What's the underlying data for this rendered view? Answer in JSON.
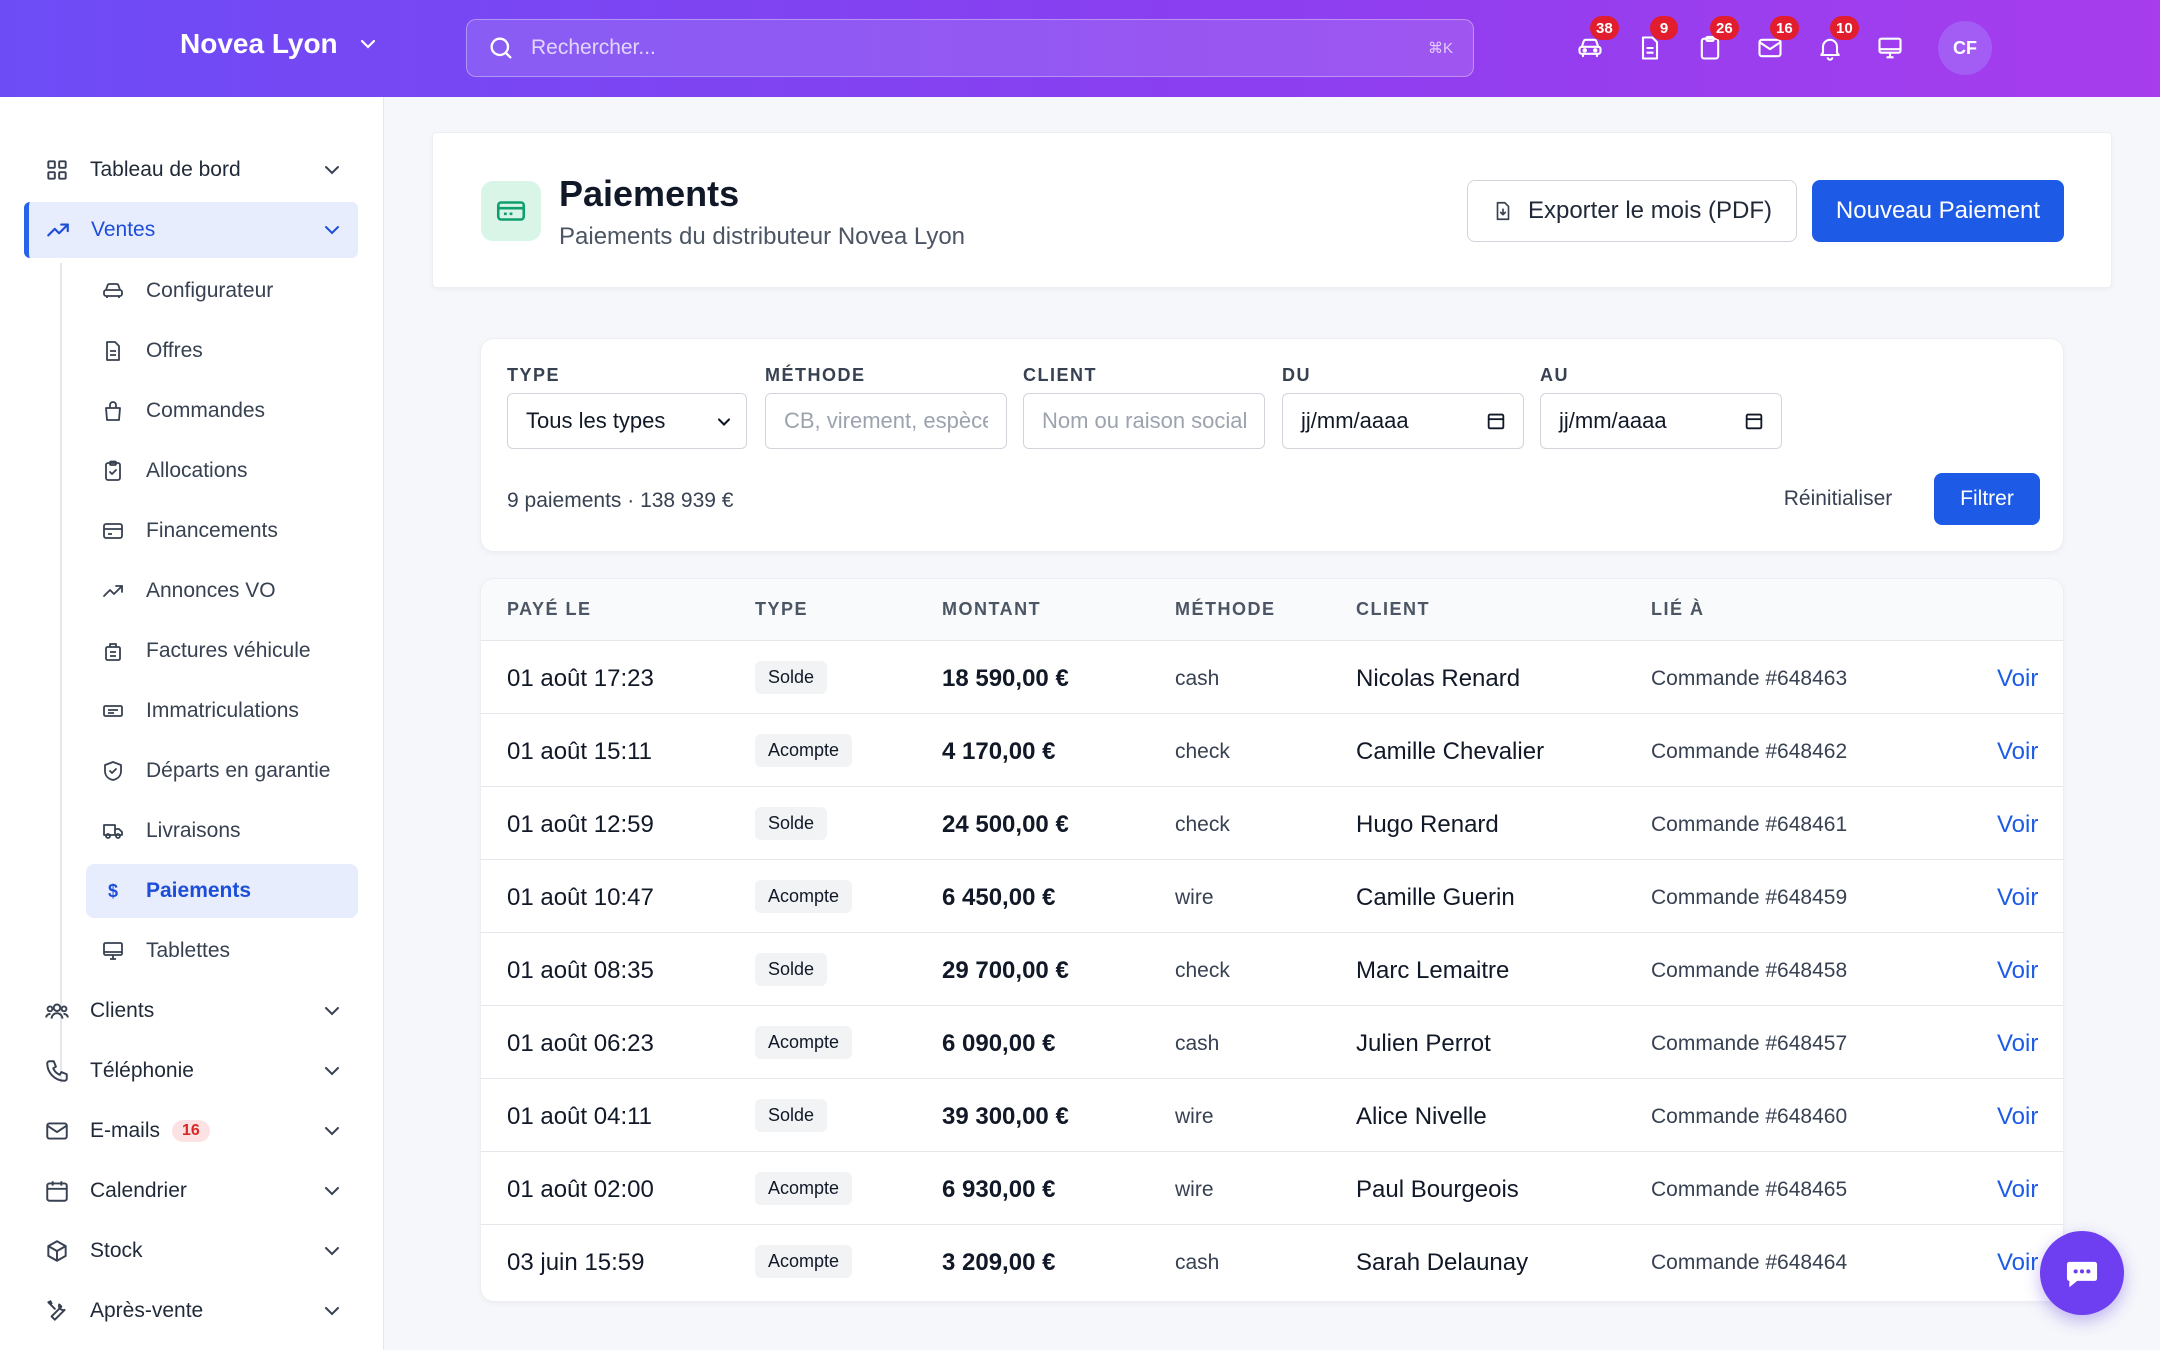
{
  "brand": {
    "name": "Novea Lyon"
  },
  "search": {
    "placeholder": "Rechercher...",
    "shortcut": "⌘K"
  },
  "notifications": [
    {
      "icon": "car-icon",
      "count": "38"
    },
    {
      "icon": "document-icon",
      "count": "9"
    },
    {
      "icon": "clipboard-icon",
      "count": "26"
    },
    {
      "icon": "mail-icon",
      "count": "16"
    },
    {
      "icon": "bell-icon",
      "count": "10"
    },
    {
      "icon": "monitor-icon",
      "count": ""
    }
  ],
  "user": {
    "initials": "CF"
  },
  "sidebar": {
    "sections": [
      {
        "label": "Tableau de bord",
        "icon": "grid-icon"
      },
      {
        "label": "Ventes",
        "icon": "trend-icon"
      },
      {
        "label": "Clients",
        "icon": "users-icon"
      },
      {
        "label": "Téléphonie",
        "icon": "phone-icon"
      },
      {
        "label": "E-mails",
        "icon": "mail-icon",
        "badge": "16"
      },
      {
        "label": "Calendrier",
        "icon": "calendar-icon"
      },
      {
        "label": "Stock",
        "icon": "cube-icon"
      },
      {
        "label": "Après-vente",
        "icon": "tools-icon"
      }
    ],
    "ventes_items": [
      {
        "label": "Configurateur",
        "icon": "car-icon"
      },
      {
        "label": "Offres",
        "icon": "document-icon"
      },
      {
        "label": "Commandes",
        "icon": "bag-icon"
      },
      {
        "label": "Allocations",
        "icon": "clipboard-check-icon"
      },
      {
        "label": "Financements",
        "icon": "credit-card-icon"
      },
      {
        "label": "Annonces VO",
        "icon": "trend-icon"
      },
      {
        "label": "Factures véhicule",
        "icon": "receipt-icon"
      },
      {
        "label": "Immatriculations",
        "icon": "plate-icon"
      },
      {
        "label": "Départs en garantie",
        "icon": "shield-icon"
      },
      {
        "label": "Livraisons",
        "icon": "truck-icon"
      },
      {
        "label": "Paiements",
        "icon": "dollar-icon"
      },
      {
        "label": "Tablettes",
        "icon": "monitor-icon"
      }
    ]
  },
  "header": {
    "title": "Paiements",
    "subtitle": "Paiements du distributeur Novea Lyon",
    "export_label": "Exporter le mois (PDF)",
    "new_label": "Nouveau Paiement"
  },
  "filters": {
    "type_label": "TYPE",
    "type_value": "Tous les types",
    "method_label": "MÉTHODE",
    "method_placeholder": "CB, virement, espèces",
    "client_label": "CLIENT",
    "client_placeholder": "Nom ou raison sociale",
    "from_label": "DU",
    "from_value": "jj/mm/aaaa",
    "to_label": "AU",
    "to_value": "jj/mm/aaaa",
    "count": "9 paiements · 138 939 €",
    "reset_label": "Réinitialiser",
    "filter_label": "Filtrer"
  },
  "table": {
    "headers": [
      "PAYÉ LE",
      "TYPE",
      "MONTANT",
      "MÉTHODE",
      "CLIENT",
      "LIÉ À"
    ],
    "action_label": "Voir",
    "rows": [
      {
        "date": "01 août 17:23",
        "type": "Solde",
        "amount": "18 590,00 €",
        "method": "cash",
        "client": "Nicolas Renard",
        "linked": "Commande #648463"
      },
      {
        "date": "01 août 15:11",
        "type": "Acompte",
        "amount": "4 170,00 €",
        "method": "check",
        "client": "Camille Chevalier",
        "linked": "Commande #648462"
      },
      {
        "date": "01 août 12:59",
        "type": "Solde",
        "amount": "24 500,00 €",
        "method": "check",
        "client": "Hugo Renard",
        "linked": "Commande #648461"
      },
      {
        "date": "01 août 10:47",
        "type": "Acompte",
        "amount": "6 450,00 €",
        "method": "wire",
        "client": "Camille Guerin",
        "linked": "Commande #648459"
      },
      {
        "date": "01 août 08:35",
        "type": "Solde",
        "amount": "29 700,00 €",
        "method": "check",
        "client": "Marc Lemaitre",
        "linked": "Commande #648458"
      },
      {
        "date": "01 août 06:23",
        "type": "Acompte",
        "amount": "6 090,00 €",
        "method": "cash",
        "client": "Julien Perrot",
        "linked": "Commande #648457"
      },
      {
        "date": "01 août 04:11",
        "type": "Solde",
        "amount": "39 300,00 €",
        "method": "wire",
        "client": "Alice Nivelle",
        "linked": "Commande #648460"
      },
      {
        "date": "01 août 02:00",
        "type": "Acompte",
        "amount": "6 930,00 €",
        "method": "wire",
        "client": "Paul Bourgeois",
        "linked": "Commande #648465"
      },
      {
        "date": "03 juin 15:59",
        "type": "Acompte",
        "amount": "3 209,00 €",
        "method": "cash",
        "client": "Sarah Delaunay",
        "linked": "Commande #648464"
      }
    ]
  },
  "colors": {
    "accent": "#1d5be6",
    "topbar_start": "#6d4cf6",
    "topbar_end": "#a73ded",
    "badge": "#e11d2e"
  }
}
